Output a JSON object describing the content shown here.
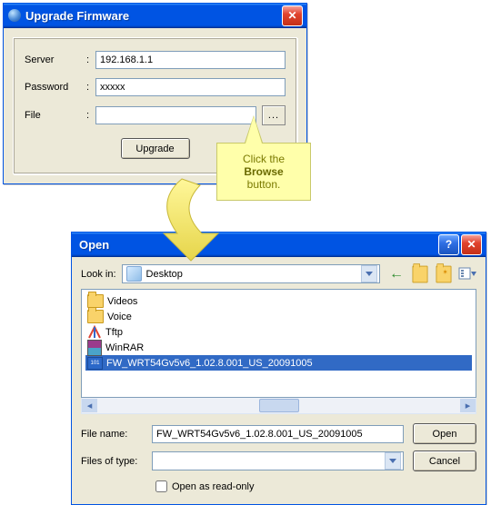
{
  "upgrade_window": {
    "title": "Upgrade Firmware",
    "server_label": "Server",
    "server_value": "192.168.1.1",
    "password_label": "Password",
    "password_value": "xxxxx",
    "file_label": "File",
    "file_value": "",
    "browse_dots": "...",
    "colon": ":",
    "upgrade_btn": "Upgrade"
  },
  "callout": {
    "line1": "Click the",
    "bold": "Browse",
    "line3": "button."
  },
  "open_dialog": {
    "title": "Open",
    "lookin_label": "Look in:",
    "lookin_value": "Desktop",
    "items": [
      {
        "icon": "folder",
        "label": "Videos",
        "selected": false
      },
      {
        "icon": "folder",
        "label": "Voice",
        "selected": false
      },
      {
        "icon": "tftp",
        "label": "Tftp",
        "selected": false
      },
      {
        "icon": "rar",
        "label": "WinRAR",
        "selected": false
      },
      {
        "icon": "bin",
        "label": "FW_WRT54Gv5v6_1.02.8.001_US_20091005",
        "selected": true
      }
    ],
    "filename_label": "File name:",
    "filename_value": "FW_WRT54Gv5v6_1.02.8.001_US_20091005",
    "filetype_label": "Files of type:",
    "filetype_value": "",
    "open_btn": "Open",
    "cancel_btn": "Cancel",
    "readonly_label": "Open as read-only",
    "toolbar": {
      "back": "←",
      "up": "folder-up",
      "newfolder": "folder-new",
      "views": "views"
    }
  }
}
